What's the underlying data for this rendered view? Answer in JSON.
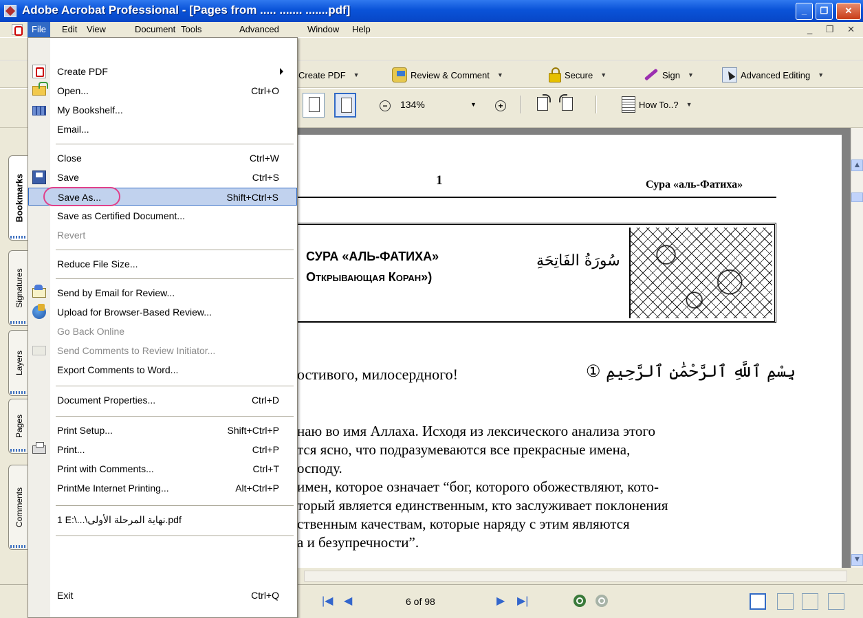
{
  "window": {
    "title": "Adobe Acrobat Professional - [Pages from ..... ....... .......pdf]",
    "controls": {
      "minimize": "_",
      "maximize": "❐",
      "close": "✕"
    }
  },
  "menubar": {
    "items": [
      "File",
      "Edit",
      "View",
      "Document",
      "Tools",
      "Advanced",
      "Window",
      "Help"
    ],
    "open_item": "File",
    "doc_controls": "_ ❐ ✕"
  },
  "toolbar1": {
    "create_pdf": "Create PDF",
    "review_comment": "Review & Comment",
    "secure": "Secure",
    "sign": "Sign",
    "advanced_editing": "Advanced Editing"
  },
  "toolbar2": {
    "zoom_level": "134%",
    "zoom_out_symbol": "−",
    "zoom_in_symbol": "+",
    "how_to": "How To..?"
  },
  "side_tabs": [
    {
      "label": "Bookmarks",
      "active": true
    },
    {
      "label": "Signatures",
      "active": false
    },
    {
      "label": "Layers",
      "active": false
    },
    {
      "label": "Pages",
      "active": false
    },
    {
      "label": "Comments",
      "active": false
    }
  ],
  "file_menu": {
    "items": [
      {
        "label": "Create PDF",
        "icon": "create-pdf-icon",
        "submenu": true
      },
      {
        "label": "Open...",
        "shortcut": "Ctrl+O",
        "icon": "open-folder-icon"
      },
      {
        "label": "My Bookshelf...",
        "icon": "bookshelf-icon"
      },
      {
        "label": "Email..."
      },
      {
        "label": "Close",
        "shortcut": "Ctrl+W"
      },
      {
        "label": "Save",
        "shortcut": "Ctrl+S",
        "icon": "floppy-disk-icon"
      },
      {
        "label": "Save As...",
        "shortcut": "Shift+Ctrl+S",
        "highlighted": true
      },
      {
        "label": "Save as Certified Document..."
      },
      {
        "label": "Revert",
        "disabled": true
      },
      {
        "label": "Reduce File Size..."
      },
      {
        "label": "Send by Email for Review...",
        "icon": "email-review-icon"
      },
      {
        "label": "Upload for Browser-Based Review...",
        "icon": "globe-upload-icon"
      },
      {
        "label": "Go Back Online",
        "disabled": true
      },
      {
        "label": "Send Comments to Review Initiator...",
        "disabled": true,
        "icon": "send-comments-icon"
      },
      {
        "label": "Export Comments to Word..."
      },
      {
        "label": "Document Properties...",
        "shortcut": "Ctrl+D"
      },
      {
        "label": "Print Setup...",
        "shortcut": "Shift+Ctrl+P"
      },
      {
        "label": "Print...",
        "shortcut": "Ctrl+P",
        "icon": "printer-icon"
      },
      {
        "label": "Print with Comments...",
        "shortcut": "Ctrl+T"
      },
      {
        "label": "PrintMe Internet Printing...",
        "shortcut": "Alt+Ctrl+P"
      },
      {
        "label": "1 E:\\...\\نهاية المرحلة الأولى.pdf"
      },
      {
        "label": "Exit",
        "shortcut": "Ctrl+Q"
      }
    ]
  },
  "document": {
    "page_number": "1",
    "header_right": "Сура «аль-Фатиха»",
    "banner_title_line1": "Сура «аль-Фатиха»",
    "banner_title_line2": "Открывающая Коран»)",
    "banner_arabic": "سُورَةُ الفَاتِحَةِ",
    "basmala_ru": "остивого, милосердного!",
    "basmala_ar": "بِسْمِ ٱللَّهِ ٱلرَّحْمَٰنِ ٱلرَّحِيمِ ①",
    "body_lines": [
      "наю во имя Аллаха. Исходя из лексического анализа этого",
      "тся ясно, что подразумеваются все прекрасные имена,",
      "осподу.",
      "имен, которое означает “бог, которого обожествляют, кото-",
      "торый является единственным, кто заслуживает поклонения",
      "ственным качествам, которые наряду с этим являются",
      "а и безупречности”."
    ]
  },
  "status": {
    "page_indicator": "6 of 98",
    "nav": {
      "first": "|◀",
      "prev": "◀",
      "next": "▶",
      "last": "▶|"
    }
  }
}
